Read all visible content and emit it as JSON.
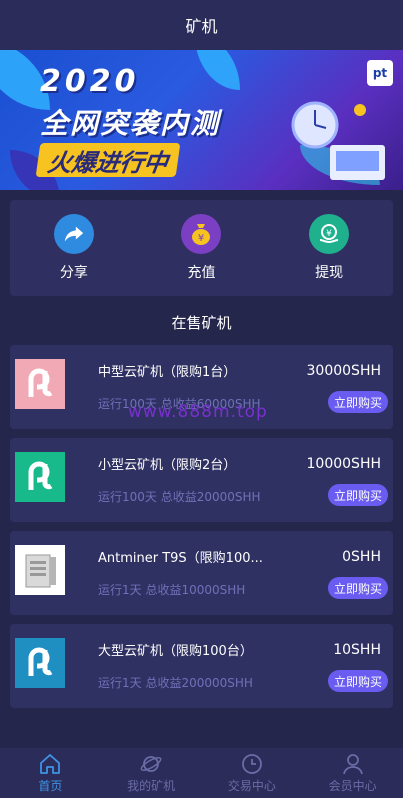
{
  "header": {
    "title": "矿机"
  },
  "banner": {
    "line1": "2020",
    "line2": "全网突袭内测",
    "line3": "火爆进行中",
    "logo_text": "pt"
  },
  "quick_actions": [
    {
      "label": "分享",
      "icon": "share-icon",
      "color": "#2f8be0"
    },
    {
      "label": "充值",
      "icon": "money-bag-icon",
      "color": "#7b3fc4"
    },
    {
      "label": "提现",
      "icon": "withdraw-icon",
      "color": "#1fb08e"
    }
  ],
  "section_title": "在售矿机",
  "products": [
    {
      "name": "中型云矿机（限购1台）",
      "sub": "运行100天 总收益60000SHH",
      "price": "30000SHH",
      "buy_label": "立即购买",
      "thumb_color": "#f1a9b5",
      "thumb": "pt-logo"
    },
    {
      "name": "小型云矿机（限购2台）",
      "sub": "运行100天 总收益20000SHH",
      "price": "10000SHH",
      "buy_label": "立即购买",
      "thumb_color": "#18b98b",
      "thumb": "pt-logo"
    },
    {
      "name": "Antminer T9S（限购100...",
      "sub": "运行1天 总收益10000SHH",
      "price": "0SHH",
      "buy_label": "立即购买",
      "thumb_color": "#ffffff",
      "thumb": "miner-device"
    },
    {
      "name": "大型云矿机（限购100台）",
      "sub": "运行1天 总收益200000SHH",
      "price": "10SHH",
      "buy_label": "立即购买",
      "thumb_color": "#1e8fc0",
      "thumb": "pt-logo"
    }
  ],
  "watermark": "www.888m.top",
  "tabs": [
    {
      "label": "首页",
      "icon": "home-icon",
      "active": true
    },
    {
      "label": "我的矿机",
      "icon": "planet-icon",
      "active": false
    },
    {
      "label": "交易中心",
      "icon": "clock-icon",
      "active": false
    },
    {
      "label": "会员中心",
      "icon": "user-icon",
      "active": false
    }
  ]
}
